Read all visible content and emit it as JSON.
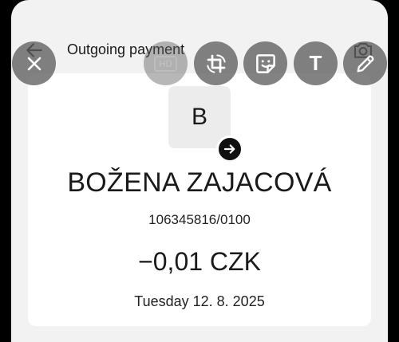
{
  "header": {
    "title": "Outgoing payment"
  },
  "payment": {
    "avatar_initial": "B",
    "recipient_name": "BOŽENA ZAJACOVÁ",
    "account_number": "106345816/0100",
    "amount": "−0,01 CZK",
    "date": "Tuesday 12. 8. 2025"
  },
  "editor_toolbar": {
    "hd_label": "HD",
    "text_tool_label": "T",
    "icons": [
      "close-icon",
      "hd-icon",
      "crop-rotate-icon",
      "sticker-icon",
      "text-icon",
      "pencil-icon"
    ]
  },
  "colors": {
    "background": "#f2f2f2",
    "card": "#ffffff",
    "overlay_button": "#5f5f5f",
    "badge": "#111111"
  }
}
